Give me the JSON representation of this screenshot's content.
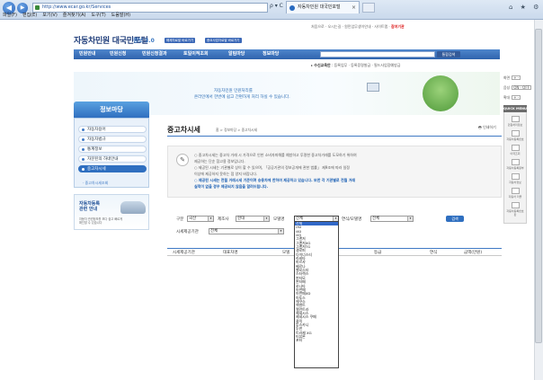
{
  "browser": {
    "url": "http://www.ecar.go.kr/Services",
    "address_tools": "ρ ▾ C",
    "tab_title": "자동차민원 대국민포털",
    "menu": [
      "파일(F)",
      "편집(E)",
      "보기(V)",
      "즐겨찾기(A)",
      "도구(T)",
      "도움말(H)"
    ],
    "window_tools": "⌂ ★ ⚙"
  },
  "header": {
    "top_links": [
      "처음으로",
      "오시는길",
      "원민업무생이안내",
      "사이트맵"
    ],
    "top_link_highlight": "참여기관",
    "logo": "자동차민원 대국민포털",
    "logo_sub": "정보 3.0",
    "badges": [
      "해제자료발 바로가기",
      "중요사업자료발 바로가기"
    ],
    "nav": [
      "민원안내",
      "민원신청",
      "민원신청결과",
      "토일이적조회",
      "알림마당",
      "정보마당"
    ],
    "search_button": "통합검색",
    "sub_nav_label": "수신교육안",
    "sub_nav_items": "등록업무 · 등록증명발급 · 필드사업장예방금"
  },
  "banner": {
    "line1": "자동차민원 민원처리를",
    "line2": "온라인에서 한번에 쉽고 간편하게 처리 하실 수 있습니다."
  },
  "sidebar": {
    "title": "정보마당",
    "items": [
      {
        "label": "자동차용어",
        "active": false
      },
      {
        "label": "자동차법규",
        "active": false
      },
      {
        "label": "통계정보",
        "active": false
      },
      {
        "label": "자문된의 하네안내",
        "active": false
      },
      {
        "label": "중고차시세",
        "active": true
      }
    ],
    "sub_item": "· 중고차시세조회",
    "promo_title": [
      "자동차등록",
      "관련 안내"
    ],
    "promo_text": "자동차 관련정보를 보다 쉽고 빠르게 확인할 수 있습니다"
  },
  "content": {
    "title": "중고차시세",
    "breadcrumb": "홈 > 정보마당 > 중고차시세",
    "print": "인쇄하기",
    "notice_icon": "✎",
    "notice": [
      {
        "text": "○ 중고차시세는 중고차 거래 시 가격으로 인한 소비자피해를 예방하고 투명한 중고차거래를 도모하기 위하여",
        "style": "normal"
      },
      {
        "text": "제공하는 단순 참고용 정보입니다.",
        "style": "normal"
      },
      {
        "text": "○ 제공된 시세는 기관별로 상이 할 수 있으며, 「공공기관의 정보공개에 관한 법률」 제9조에 따라 일정",
        "style": "normal"
      },
      {
        "text": "이상에 제공하지 못하는 점 양지 바랍니다.",
        "style": "normal"
      },
      {
        "text": "○ 제공된 시세는 전월 거래시세 기준이며 승용차에 한하여 제공하고 있습니다. 또한 각 기관별로 전월 거래",
        "style": "blue"
      },
      {
        "text": "실적이 없을 경우 제공되지 않음을 알려드립니다.",
        "style": "blue"
      }
    ]
  },
  "filters": {
    "type_label": "구분",
    "type_value": "국산",
    "maker_label": "제조사",
    "maker_value": "현대",
    "model_label": "모델명",
    "model_value": "전체",
    "fuel_label": "연식/모델명",
    "fuel_value": "전체",
    "search_button": "검색",
    "org_label": "시세제공기관",
    "org_value": "전체"
  },
  "table": {
    "headers": [
      "시세제공기관",
      "대표차명",
      "모델",
      "등급",
      "연식",
      "금액(만원)"
    ]
  },
  "dropdown": {
    "items": [
      "전체",
      "i30",
      "i40",
      "i45",
      "그랜저",
      "그랜저XG",
      "그랜저TG",
      "갤로퍼",
      "다이너스티",
      "라비타",
      "마르샤",
      "베르나",
      "벨로스터",
      "스타렉스",
      "싼타모",
      "싼타페",
      "쏘나타",
      "아반떼",
      "아반떼XD",
      "아토스",
      "에쿠스",
      "엑센트",
      "엘란트라",
      "제네시스",
      "제네시스 쿠페",
      "클릭",
      "투스카니",
      "투싼",
      "트라제 XG",
      "티뷰론",
      "포터"
    ],
    "selected_index": 0
  },
  "quick_bar": {
    "rows": [
      {
        "label": "화면",
        "control": "+ -"
      },
      {
        "label": "음성",
        "control": "ON · OFF"
      },
      {
        "label": "확대",
        "control": "+ -"
      }
    ],
    "head": "QUICK MENU",
    "items": [
      "민원처리정보",
      "자동차등록번호",
      "이력조회",
      "자동차등록원부",
      "자동차정보",
      "자동차 리콜",
      "자동차등록번호판"
    ]
  }
}
